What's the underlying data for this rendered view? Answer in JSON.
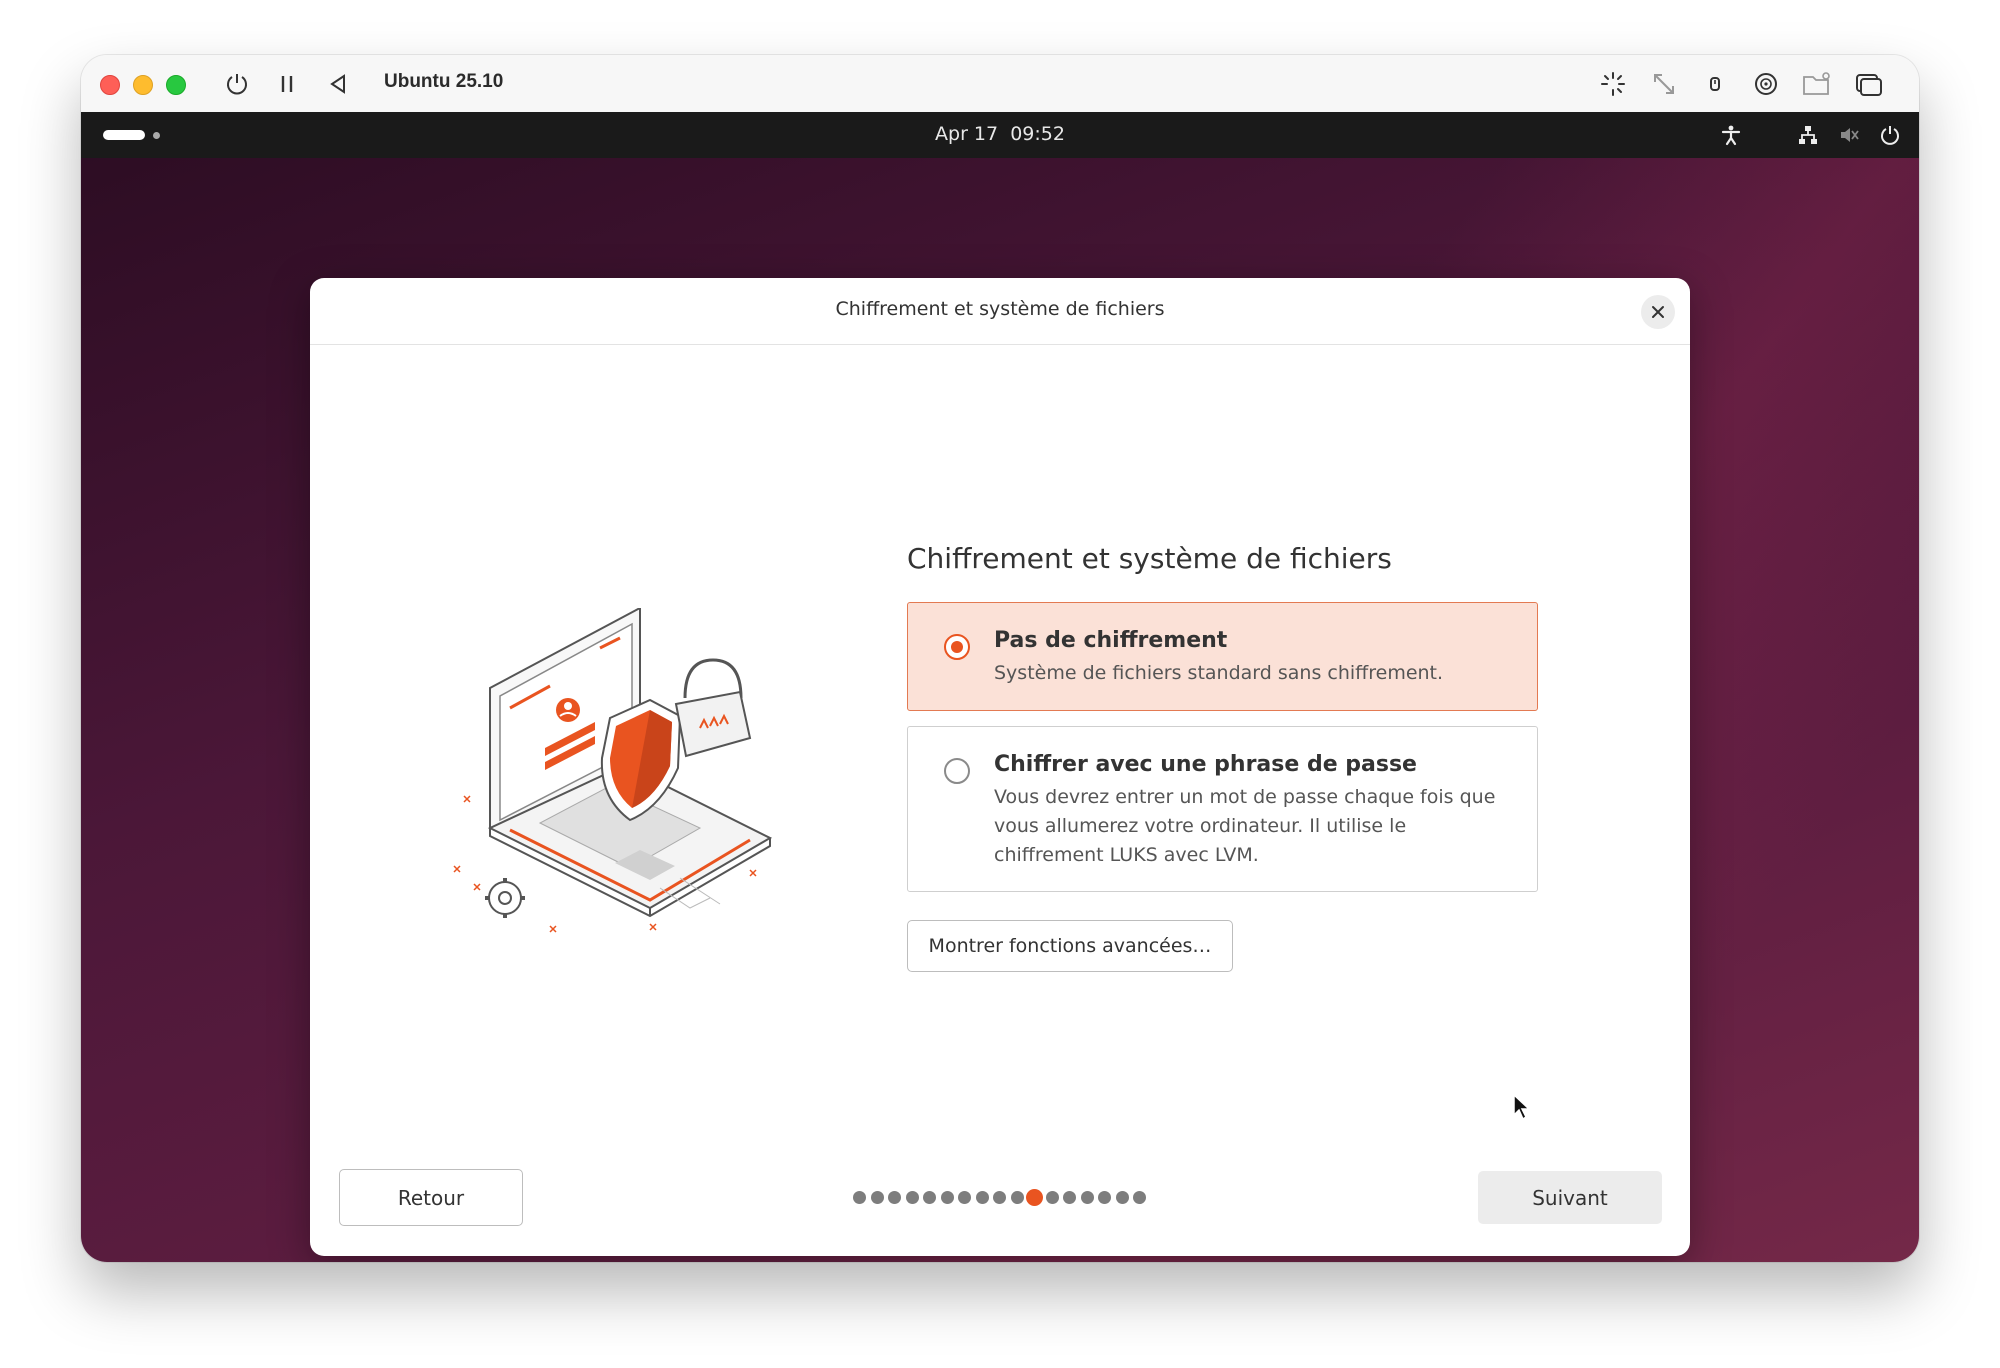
{
  "vm_window": {
    "title": "Ubuntu 25.10"
  },
  "topbar": {
    "date": "Apr 17",
    "time": "09:52"
  },
  "dialog": {
    "title": "Chiffrement et système de fichiers",
    "heading": "Chiffrement et système de fichiers",
    "options": [
      {
        "title": "Pas de chiffrement",
        "description": "Système de fichiers standard sans chiffrement.",
        "selected": true
      },
      {
        "title": "Chiffrer avec une phrase de passe",
        "description_lines": [
          "Vous devrez entrer un mot de passe chaque fois que",
          "vous allumerez votre ordinateur. Il utilise le",
          "chiffrement LUKS avec LVM."
        ],
        "selected": false
      }
    ],
    "advanced_button": "Montrer fonctions avancées…",
    "back_button": "Retour",
    "next_button": "Suivant",
    "progress": {
      "total_steps": 17,
      "current_step": 11
    }
  },
  "colors": {
    "accent": "#e95420",
    "selected_bg": "#fbe1d7",
    "topbar_bg": "#1a1a1a"
  }
}
